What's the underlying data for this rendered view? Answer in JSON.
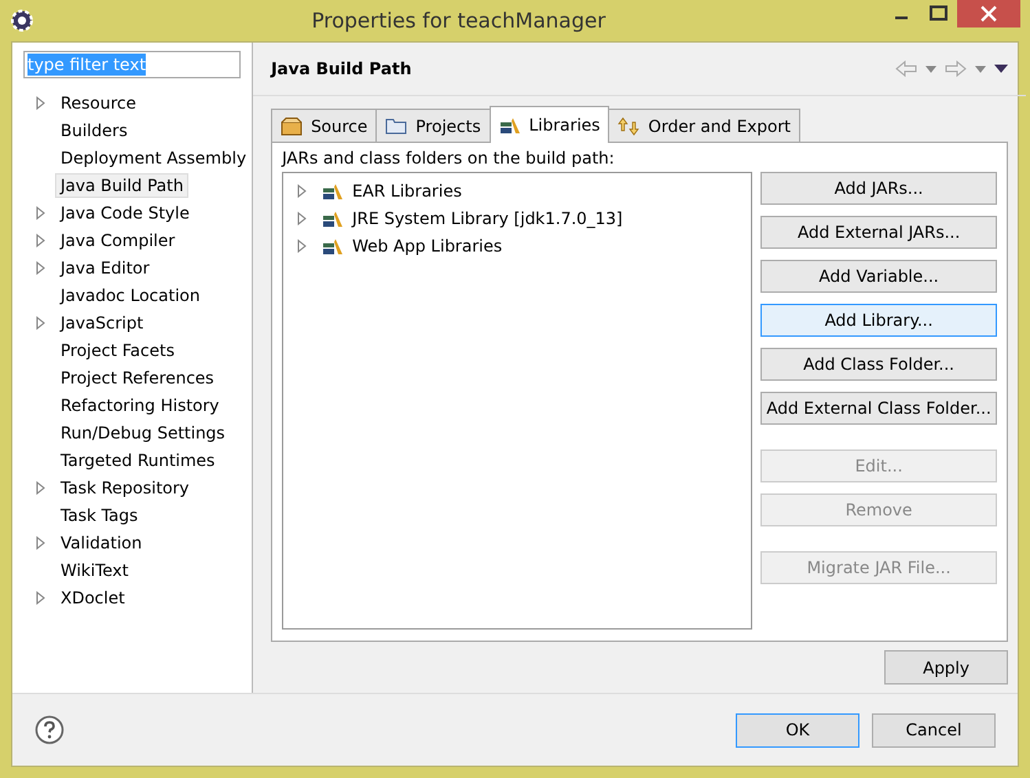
{
  "window": {
    "title": "Properties for teachManager"
  },
  "filter": {
    "value": "type filter text",
    "selected": true
  },
  "sidebar": {
    "items": [
      {
        "label": "Resource",
        "expandable": true,
        "selected": false
      },
      {
        "label": "Builders",
        "expandable": false,
        "selected": false
      },
      {
        "label": "Deployment Assembly",
        "expandable": false,
        "selected": false
      },
      {
        "label": "Java Build Path",
        "expandable": false,
        "selected": true
      },
      {
        "label": "Java Code Style",
        "expandable": true,
        "selected": false
      },
      {
        "label": "Java Compiler",
        "expandable": true,
        "selected": false
      },
      {
        "label": "Java Editor",
        "expandable": true,
        "selected": false
      },
      {
        "label": "Javadoc Location",
        "expandable": false,
        "selected": false
      },
      {
        "label": "JavaScript",
        "expandable": true,
        "selected": false
      },
      {
        "label": "Project Facets",
        "expandable": false,
        "selected": false
      },
      {
        "label": "Project References",
        "expandable": false,
        "selected": false
      },
      {
        "label": "Refactoring History",
        "expandable": false,
        "selected": false
      },
      {
        "label": "Run/Debug Settings",
        "expandable": false,
        "selected": false
      },
      {
        "label": "Targeted Runtimes",
        "expandable": false,
        "selected": false
      },
      {
        "label": "Task Repository",
        "expandable": true,
        "selected": false
      },
      {
        "label": "Task Tags",
        "expandable": false,
        "selected": false
      },
      {
        "label": "Validation",
        "expandable": true,
        "selected": false
      },
      {
        "label": "WikiText",
        "expandable": false,
        "selected": false
      },
      {
        "label": "XDoclet",
        "expandable": true,
        "selected": false
      }
    ]
  },
  "page": {
    "title": "Java Build Path"
  },
  "tabs": [
    {
      "label": "Source",
      "kind": "source",
      "selected": false
    },
    {
      "label": "Projects",
      "kind": "projects",
      "selected": false
    },
    {
      "label": "Libraries",
      "kind": "libraries",
      "selected": true
    },
    {
      "label": "Order and Export",
      "kind": "order",
      "selected": false
    }
  ],
  "list_label": "JARs and class folders on the build path:",
  "libraries": [
    {
      "label": "EAR Libraries",
      "expanded": false
    },
    {
      "label": "JRE System Library [jdk1.7.0_13]",
      "expanded": false
    },
    {
      "label": "Web App Libraries",
      "expanded": false
    }
  ],
  "add_buttons": [
    {
      "label": "Add JARs...",
      "disabled": false,
      "focused": false
    },
    {
      "label": "Add External JARs...",
      "disabled": false,
      "focused": false
    },
    {
      "label": "Add Variable...",
      "disabled": false,
      "focused": false
    },
    {
      "label": "Add Library...",
      "disabled": false,
      "focused": true
    },
    {
      "label": "Add Class Folder...",
      "disabled": false,
      "focused": false
    },
    {
      "label": "Add External Class Folder...",
      "disabled": false,
      "focused": false
    }
  ],
  "edit_buttons": [
    {
      "label": "Edit...",
      "disabled": true,
      "focused": false
    },
    {
      "label": "Remove",
      "disabled": true,
      "focused": false
    }
  ],
  "migrate_button": {
    "label": "Migrate JAR File...",
    "disabled": true,
    "focused": false
  },
  "apply_button": {
    "label": "Apply"
  },
  "footer_buttons": [
    {
      "label": "OK",
      "default": true
    },
    {
      "label": "Cancel",
      "default": false
    }
  ]
}
